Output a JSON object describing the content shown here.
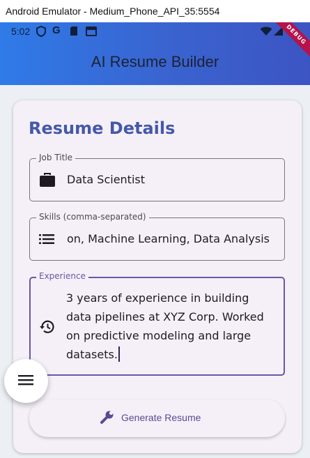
{
  "window": {
    "title": "Android Emulator - Medium_Phone_API_35:5554"
  },
  "status_bar": {
    "time": "5:02",
    "left_icons": [
      "shield-icon",
      "google-g-icon",
      "sd-card-icon",
      "window-icon"
    ],
    "right_icons": [
      "wifi-icon",
      "signal-icon"
    ],
    "debug_banner": "DEBUG"
  },
  "app_bar": {
    "title": "AI Resume Builder"
  },
  "form": {
    "heading": "Resume Details",
    "job_title": {
      "label": "Job Title",
      "value": "Data Scientist",
      "icon": "briefcase-icon"
    },
    "skills": {
      "label": "Skills (comma-separated)",
      "value": "on, Machine Learning, Data Analysis",
      "icon": "list-icon"
    },
    "experience": {
      "label": "Experience",
      "value": "3 years of experience in building data pipelines at XYZ Corp. Worked on predictive modeling and large datasets.",
      "icon": "history-icon"
    },
    "generate_button": {
      "label": "Generate Resume",
      "icon": "wrench-icon"
    }
  },
  "fab": {
    "icon": "menu-icon"
  },
  "colors": {
    "accent": "#4558a9",
    "focus": "#6b56a7",
    "app_bar_start": "#2f7be8",
    "app_bar_end": "#3c55c3",
    "card": "#f5f0f8",
    "debug": "#b5134b"
  }
}
